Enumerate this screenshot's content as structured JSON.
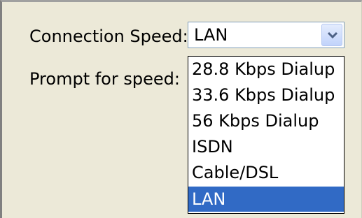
{
  "form": {
    "connection_speed_label": "Connection Speed:",
    "prompt_label": "Prompt for speed:",
    "selected_value": "LAN"
  },
  "dropdown": {
    "options": [
      "28.8 Kbps Dialup",
      "33.6 Kbps Dialup",
      "56 Kbps Dialup",
      "ISDN",
      "Cable/DSL",
      "LAN"
    ],
    "highlighted": "LAN"
  },
  "colors": {
    "dialog_bg": "#ece9d8",
    "highlight": "#316ac5",
    "field_border": "#7f9db9"
  }
}
